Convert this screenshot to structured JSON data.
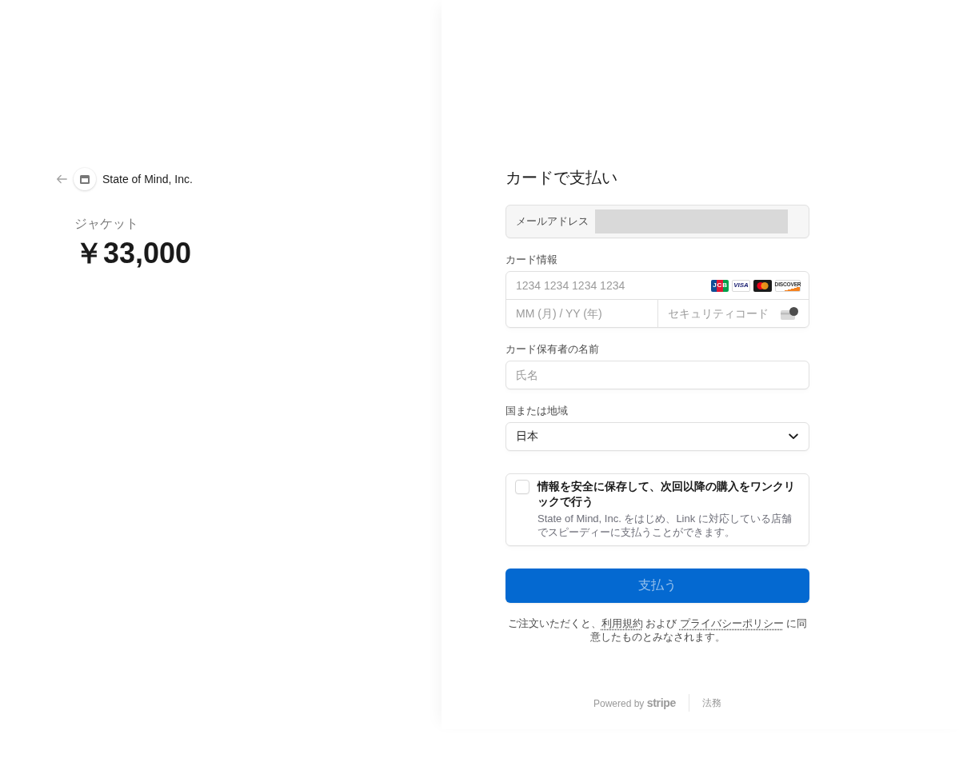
{
  "merchant": {
    "name": "State of Mind, Inc."
  },
  "product": {
    "name": "ジャケット",
    "price": "￥33,000"
  },
  "payment": {
    "title": "カードで支払い",
    "email": {
      "label": "メールアドレス"
    },
    "card": {
      "label": "カード情報",
      "number_placeholder": "1234 1234 1234 1234",
      "brands": [
        {
          "kind": "jcb",
          "label": "JCB"
        },
        {
          "kind": "visa",
          "label": "VISA"
        },
        {
          "kind": "mastercard"
        },
        {
          "kind": "discover",
          "label": "DISCOVER"
        }
      ],
      "expiry_placeholder": "MM (月) / YY (年)",
      "cvc_placeholder": "セキュリティコード"
    },
    "cardholder": {
      "label": "カード保有者の名前",
      "placeholder": "氏名"
    },
    "country": {
      "label": "国または地域",
      "value": "日本"
    },
    "save_info": {
      "checked": false,
      "title": "情報を安全に保存して、次回以降の購入をワンクリックで行う",
      "description": "State of Mind, Inc. をはじめ、Link に対応している店舗でスピーディーに支払うことができます。"
    },
    "pay_button": {
      "label": "支払う",
      "disabled": true
    },
    "terms": [
      {
        "kind": "text",
        "text": "ご注文いただくと、"
      },
      {
        "kind": "link",
        "text": "利用規約"
      },
      {
        "kind": "text",
        "text": " および "
      },
      {
        "kind": "link",
        "text": "プライバシーポリシー"
      },
      {
        "kind": "text",
        "text": " に同意したものとみなされます。"
      }
    ]
  },
  "footer": {
    "powered_by": "Powered by **stripe**",
    "links": [
      "法務"
    ]
  }
}
